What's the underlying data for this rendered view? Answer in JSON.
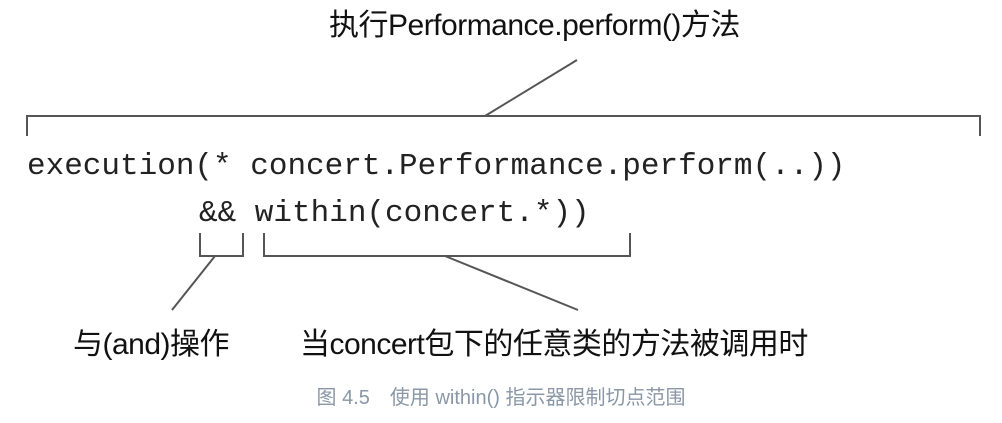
{
  "annotations": {
    "top_label": "执行Performance.perform()方法",
    "and_label": "与(and)操作",
    "within_label": "当concert包下的任意类的方法被调用时"
  },
  "code": {
    "line1": "execution(* concert.Performance.perform(..))",
    "line2": "&& within(concert.*))"
  },
  "caption": "图 4.5　使用 within() 指示器限制切点范围",
  "colors": {
    "text": "#111111",
    "code": "#222222",
    "lines": "#555555",
    "caption": "#8a97a6"
  }
}
